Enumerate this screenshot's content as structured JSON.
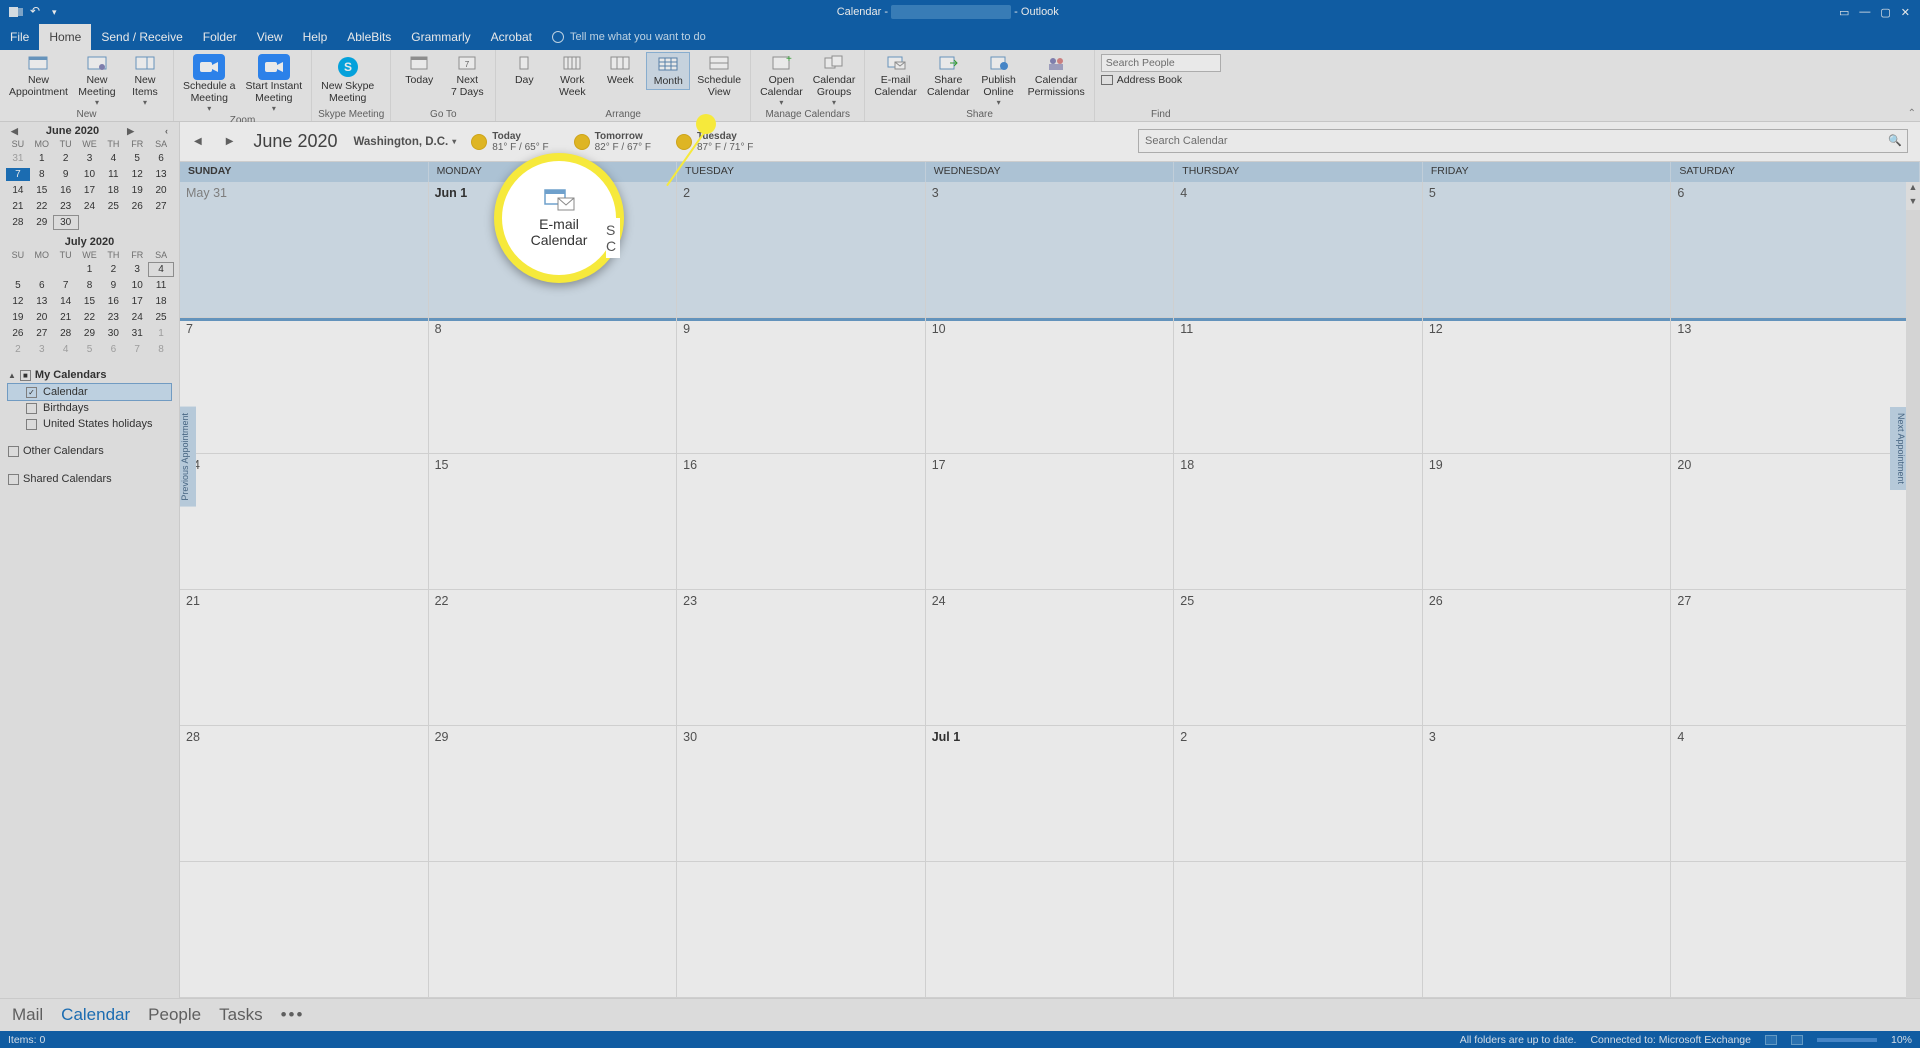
{
  "title": {
    "left": "Calendar -",
    "right": "- Outlook"
  },
  "window_controls": {
    "min": "—",
    "max": "▢",
    "close": "✕",
    "mode": "▭"
  },
  "tabs": [
    "File",
    "Home",
    "Send / Receive",
    "Folder",
    "View",
    "Help",
    "AbleBits",
    "Grammarly",
    "Acrobat"
  ],
  "active_tab_index": 1,
  "tell_me": "Tell me what you want to do",
  "ribbon": {
    "new": {
      "label": "New",
      "appointment": "New\nAppointment",
      "meeting": "New\nMeeting",
      "items": "New\nItems"
    },
    "zoom": {
      "label": "Zoom",
      "schedule": "Schedule a\nMeeting",
      "instant": "Start Instant\nMeeting"
    },
    "skype": {
      "label": "Skype Meeting",
      "btn": "New Skype\nMeeting"
    },
    "goto": {
      "label": "Go To",
      "today": "Today",
      "next7": "Next\n7 Days"
    },
    "arrange": {
      "label": "Arrange",
      "day": "Day",
      "work": "Work\nWeek",
      "week": "Week",
      "month": "Month",
      "sched": "Schedule\nView"
    },
    "manage": {
      "label": "Manage Calendars",
      "open": "Open\nCalendar",
      "groups": "Calendar\nGroups"
    },
    "share": {
      "label": "Share",
      "email": "E-mail\nCalendar",
      "sharec": "Share\nCalendar",
      "publish": "Publish\nOnline",
      "perm": "Calendar\nPermissions"
    },
    "find": {
      "label": "Find",
      "search_ph": "Search People",
      "addr": "Address Book"
    }
  },
  "minical1": {
    "title": "June 2020",
    "days": [
      "SU",
      "MO",
      "TU",
      "WE",
      "TH",
      "FR",
      "SA"
    ],
    "cells": [
      {
        "n": "31",
        "o": true
      },
      {
        "n": "1"
      },
      {
        "n": "2"
      },
      {
        "n": "3"
      },
      {
        "n": "4"
      },
      {
        "n": "5"
      },
      {
        "n": "6"
      },
      {
        "n": "7",
        "today": true
      },
      {
        "n": "8"
      },
      {
        "n": "9"
      },
      {
        "n": "10"
      },
      {
        "n": "11"
      },
      {
        "n": "12"
      },
      {
        "n": "13"
      },
      {
        "n": "14"
      },
      {
        "n": "15"
      },
      {
        "n": "16"
      },
      {
        "n": "17"
      },
      {
        "n": "18"
      },
      {
        "n": "19"
      },
      {
        "n": "20"
      },
      {
        "n": "21"
      },
      {
        "n": "22"
      },
      {
        "n": "23"
      },
      {
        "n": "24"
      },
      {
        "n": "25"
      },
      {
        "n": "26"
      },
      {
        "n": "27"
      },
      {
        "n": "28"
      },
      {
        "n": "29"
      },
      {
        "n": "30",
        "box": true
      }
    ]
  },
  "minical2": {
    "title": "July 2020",
    "days": [
      "SU",
      "MO",
      "TU",
      "WE",
      "TH",
      "FR",
      "SA"
    ],
    "cells": [
      {
        "n": "",
        "o": true
      },
      {
        "n": "",
        "o": true
      },
      {
        "n": "",
        "o": true
      },
      {
        "n": "1"
      },
      {
        "n": "2"
      },
      {
        "n": "3"
      },
      {
        "n": "4",
        "box": true
      },
      {
        "n": "5"
      },
      {
        "n": "6"
      },
      {
        "n": "7"
      },
      {
        "n": "8"
      },
      {
        "n": "9"
      },
      {
        "n": "10"
      },
      {
        "n": "11"
      },
      {
        "n": "12"
      },
      {
        "n": "13"
      },
      {
        "n": "14"
      },
      {
        "n": "15"
      },
      {
        "n": "16"
      },
      {
        "n": "17"
      },
      {
        "n": "18"
      },
      {
        "n": "19"
      },
      {
        "n": "20"
      },
      {
        "n": "21"
      },
      {
        "n": "22"
      },
      {
        "n": "23"
      },
      {
        "n": "24"
      },
      {
        "n": "25"
      },
      {
        "n": "26"
      },
      {
        "n": "27"
      },
      {
        "n": "28"
      },
      {
        "n": "29"
      },
      {
        "n": "30"
      },
      {
        "n": "31"
      },
      {
        "n": "1",
        "o": true
      },
      {
        "n": "2",
        "o": true
      },
      {
        "n": "3",
        "o": true
      },
      {
        "n": "4",
        "o": true
      },
      {
        "n": "5",
        "o": true
      },
      {
        "n": "6",
        "o": true
      },
      {
        "n": "7",
        "o": true
      },
      {
        "n": "8",
        "o": true
      }
    ]
  },
  "tree": {
    "my": "My Calendars",
    "items": [
      {
        "label": "Calendar",
        "checked": true,
        "selected": true
      },
      {
        "label": "Birthdays",
        "checked": false
      },
      {
        "label": "United States holidays",
        "checked": false
      }
    ],
    "other": "Other Calendars",
    "shared": "Shared Calendars"
  },
  "calhead": {
    "month": "June 2020",
    "location": "Washington, D.C.",
    "weather": [
      {
        "label": "Today",
        "temp": "81° F / 65° F"
      },
      {
        "label": "Tomorrow",
        "temp": "82° F / 67° F"
      },
      {
        "label": "Tuesday",
        "temp": "87° F / 71° F"
      }
    ],
    "search_ph": "Search Calendar"
  },
  "dayheaders": [
    "SUNDAY",
    "MONDAY",
    "TUESDAY",
    "WEDNESDAY",
    "THURSDAY",
    "FRIDAY",
    "SATURDAY"
  ],
  "gridlabels": [
    "May 31",
    "Jun 1",
    "2",
    "3",
    "4",
    "5",
    "6",
    "7",
    "8",
    "9",
    "10",
    "11",
    "12",
    "13",
    "14",
    "15",
    "16",
    "17",
    "18",
    "19",
    "20",
    "21",
    "22",
    "23",
    "24",
    "25",
    "26",
    "27",
    "28",
    "29",
    "30",
    "Jul 1",
    "2",
    "3",
    "4",
    "",
    "",
    "",
    "",
    "",
    "",
    ""
  ],
  "sidetabs": {
    "prev": "Previous Appointment",
    "next": "Next Appointment"
  },
  "spotlight": {
    "l1": "E-mail",
    "l2": "Calendar"
  },
  "nav": [
    "Mail",
    "Calendar",
    "People",
    "Tasks"
  ],
  "nav_active_index": 1,
  "status": {
    "left": "Items: 0",
    "folders": "All folders are up to date.",
    "conn": "Connected to: Microsoft Exchange",
    "zoom": "10%"
  }
}
